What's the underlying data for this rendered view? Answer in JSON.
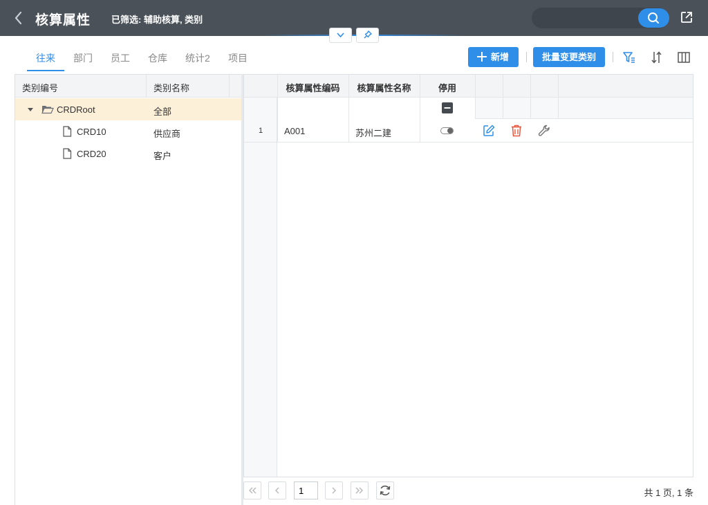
{
  "header": {
    "title": "核算属性",
    "filter_text": "已筛选: 辅助核算, 类别",
    "search_placeholder": ""
  },
  "tabs": [
    {
      "label": "往来",
      "active": true
    },
    {
      "label": "部门",
      "active": false
    },
    {
      "label": "员工",
      "active": false
    },
    {
      "label": "仓库",
      "active": false
    },
    {
      "label": "统计2",
      "active": false
    },
    {
      "label": "项目",
      "active": false
    }
  ],
  "toolbar": {
    "add_label": "新增",
    "batch_label": "批量变更类别"
  },
  "tree": {
    "headers": {
      "code": "类别编号",
      "name": "类别名称"
    },
    "nodes": [
      {
        "code": "CRDRoot",
        "name": "全部",
        "selected": true,
        "type": "folder"
      },
      {
        "code": "CRD10",
        "name": "供应商",
        "selected": false,
        "type": "file"
      },
      {
        "code": "CRD20",
        "name": "客户",
        "selected": false,
        "type": "file"
      }
    ]
  },
  "grid": {
    "headers": {
      "code": "核算属性编码",
      "name": "核算属性名称",
      "disabled": "停用"
    },
    "rows": [
      {
        "num": "1",
        "code": "A001",
        "name": "苏州二建",
        "disabled": false
      }
    ]
  },
  "pager": {
    "current_page": "1",
    "info": "共 1 页, 1 条"
  },
  "colors": {
    "header_bg": "#4a5159",
    "accent": "#2f8ee8",
    "selected_row": "#fdf0d9",
    "delete_red": "#e8553d"
  }
}
